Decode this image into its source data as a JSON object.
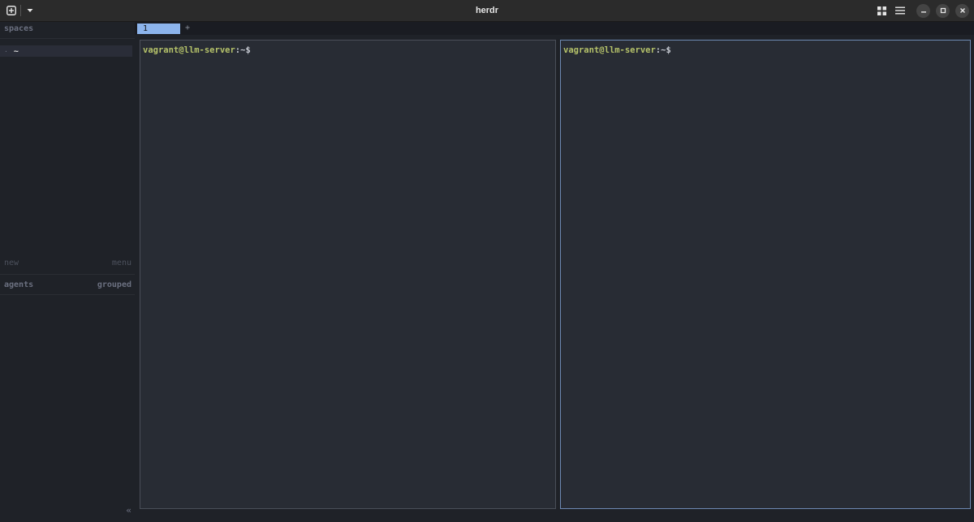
{
  "window": {
    "title": "herdr",
    "new_tab_icon": "plus-square-icon",
    "dropdown_icon": "chevron-down-icon",
    "grid_icon": "grid-icon",
    "menu_icon": "hamburger-icon",
    "minimize_icon": "minimize-icon",
    "maximize_icon": "maximize-icon",
    "close_icon": "close-icon"
  },
  "sidebar": {
    "spaces_header": "spaces",
    "spaces": [
      {
        "bullet": "·",
        "label": "~"
      }
    ],
    "new_label": "new",
    "menu_label": "menu",
    "agents_header": "agents",
    "agents_mode": "grouped",
    "collapse_glyph": "«"
  },
  "tabs": {
    "items": [
      {
        "label": "1"
      }
    ],
    "add_label": "+"
  },
  "panes": [
    {
      "user_host": "vagrant@llm-server",
      "path": ":~$"
    },
    {
      "user_host": "vagrant@llm-server",
      "path": ":~$"
    }
  ],
  "colors": {
    "accent": "#8cb4ec",
    "prompt_user": "#b5c26a",
    "active_pane_border": "#6d89b3"
  }
}
